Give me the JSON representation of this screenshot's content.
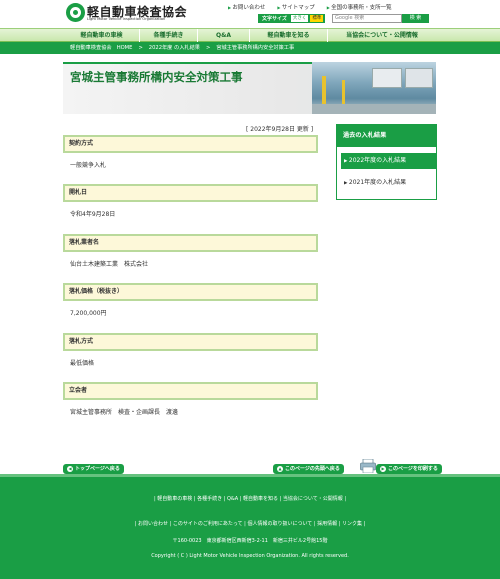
{
  "header": {
    "logo_jp": "軽自動車検査協会",
    "logo_en": "Light Motor Vehicle Inspection Organization",
    "top_links": [
      "お問い合わせ",
      "サイトマップ",
      "全国の事務所・支所一覧"
    ],
    "font_size_label": "文字サイズ",
    "font_size_large": "大きく",
    "font_size_standard": "標準",
    "search_placeholder": "Google 検索",
    "search_button": "検 索"
  },
  "gnav": [
    "軽自動車の車検",
    "各種手続き",
    "Q&A",
    "軽自動車を知る",
    "当協会について・公開情報"
  ],
  "breadcrumb": [
    "軽自動車検査協会　HOME",
    ">",
    "2022年度 の入札結果",
    ">",
    "宮城主管事務所構内安全対策工事"
  ],
  "page": {
    "title": "宮城主管事務所構内安全対策工事",
    "updated": "[ 2022年9月28日 更新 ]"
  },
  "sections": [
    {
      "head": "契約方式",
      "body": "一般競争入札"
    },
    {
      "head": "開札日",
      "body": "令和4年9月28日"
    },
    {
      "head": "落札業者名",
      "body": "仙台土木建築工業　株式会社"
    },
    {
      "head": "落札価格（税抜き）",
      "body": "7,200,000円"
    },
    {
      "head": "落札方式",
      "body": "最低価格"
    },
    {
      "head": "立会者",
      "body": "宮城主管事務所　検査・企画課長　渡邊"
    }
  ],
  "side": {
    "title": "過去の入札結果",
    "items": [
      "2022年度の入札結果",
      "2021年度の入札結果"
    ]
  },
  "buttons": {
    "to_top": "トップページへ戻る",
    "to_page_top": "このページの先頭へ戻る",
    "print": "このページを印刷する"
  },
  "footer": {
    "nav1": "| 軽自動車の車検 | 各種手続き | Q&A | 軽自動車を知る | 当協会について・公開情報 |",
    "nav2": "| お問い合わせ | このサイトのご利用にあたって | 個人情報の取り扱いについて | 採用情報 | リンク集 |",
    "address": "〒160-0023　東京都新宿区西新宿3-2-11　新宿三井ビル2号館15階",
    "copyright": "Copyright ( C ) Light Motor Vehicle Inspection Organization. All rights reserved."
  },
  "colors": {
    "brand_green": "#1a9e45",
    "section_bg": "#fdf8d9",
    "section_border": "#b9d99b"
  }
}
